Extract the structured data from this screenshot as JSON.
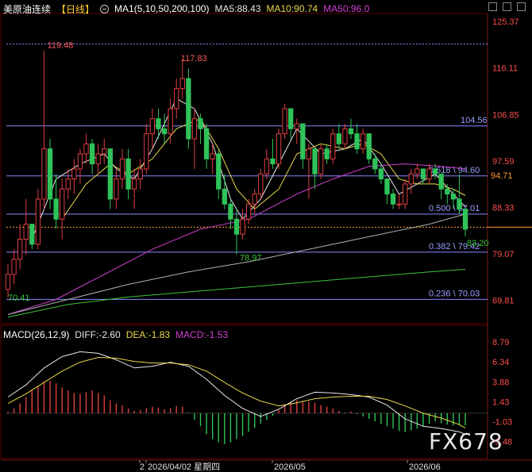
{
  "header": {
    "title": "美原油连续",
    "period": "【日线】",
    "ma_label": "MA1(5,10,50,200,100)",
    "ma5": "MA5:88.43",
    "ma10": "MA10:90.74",
    "ma50": "MA50:96.0"
  },
  "macd_header": {
    "label": "MACD(26,12,9)",
    "diff": "DIFF:-2.60",
    "dea": "DEA:-1.83",
    "macd": "MACD:-1.53"
  },
  "colors": {
    "background": "#000000",
    "up": "#e04040",
    "down": "#2fc35a",
    "ma5": "#e8e8e8",
    "ma10": "#e8d84a",
    "ma50": "#d040d0",
    "ma200": "#b0b0b0",
    "ma100": "#3cc43c",
    "fib_line": "#8a8aff",
    "current_price": "#ff9a2e",
    "price_axis": "#ff4d4d",
    "macd_axis": "#ff4d4d"
  },
  "watermark": "FX678",
  "chart_data": [
    {
      "type": "candlestick",
      "title": "美原油连续【日线】",
      "ylim": [
        65.5,
        126.8
      ],
      "y_ticks": [
        "125.37",
        "116.11",
        "106.85",
        "97.59",
        "88.33",
        "79.07",
        "69.81"
      ],
      "x_ticks": [
        "2",
        "2026/04/02 星期四",
        "2026/05",
        "2026/06"
      ],
      "current_price": "94.71",
      "extremes": {
        "high": "119.48",
        "high2": "117.83",
        "low": "70.41",
        "low2": "78.97",
        "last_low": "83.20"
      },
      "fib_levels": [
        {
          "label": "104.56",
          "value": 104.56
        },
        {
          "label": "0.618 \\ 94.60",
          "value": 94.6
        },
        {
          "label": "0.500 \\ 87.01",
          "value": 87.01
        },
        {
          "label": "0.382 \\ 79.42",
          "value": 79.42
        },
        {
          "label": "0.236 \\ 70.03",
          "value": 70.03
        }
      ],
      "dotted_lines": [
        120.9,
        84.4
      ],
      "ohlc": [
        [
          72,
          77,
          70.4,
          75
        ],
        [
          75,
          80,
          73,
          78
        ],
        [
          78,
          85,
          76,
          82
        ],
        [
          82,
          90,
          79,
          85
        ],
        [
          85,
          84,
          80,
          81
        ],
        [
          81,
          92,
          80,
          90
        ],
        [
          90,
          119.48,
          88,
          100
        ],
        [
          100,
          102,
          88,
          90
        ],
        [
          90,
          95,
          84,
          86
        ],
        [
          86,
          94,
          82,
          92
        ],
        [
          92,
          96,
          90,
          94
        ],
        [
          94,
          98,
          91,
          96
        ],
        [
          96,
          100,
          93,
          99
        ],
        [
          99,
          103,
          97,
          101
        ],
        [
          101,
          102,
          95,
          97
        ],
        [
          97,
          101,
          95,
          99
        ],
        [
          99,
          102,
          97,
          100
        ],
        [
          100,
          99,
          88,
          90
        ],
        [
          90,
          96,
          88,
          94
        ],
        [
          94,
          100,
          92,
          98
        ],
        [
          98,
          100,
          90,
          92
        ],
        [
          92,
          96,
          88,
          94
        ],
        [
          94,
          98,
          92,
          96
        ],
        [
          96,
          105,
          95,
          103
        ],
        [
          103,
          108,
          100,
          106
        ],
        [
          106,
          108,
          102,
          104
        ],
        [
          104,
          107,
          101,
          103
        ],
        [
          103,
          110,
          101,
          108
        ],
        [
          108,
          114,
          106,
          112
        ],
        [
          112,
          117.83,
          110,
          114
        ],
        [
          114,
          116,
          100,
          102
        ],
        [
          102,
          108,
          96,
          106
        ],
        [
          106,
          107,
          101,
          104
        ],
        [
          104,
          105,
          96,
          98
        ],
        [
          98,
          101,
          95,
          99
        ],
        [
          99,
          100,
          90,
          92
        ],
        [
          92,
          95,
          88,
          89
        ],
        [
          89,
          90,
          84,
          86
        ],
        [
          86,
          88,
          78.97,
          83
        ],
        [
          83,
          88,
          82,
          86
        ],
        [
          86,
          90,
          85,
          89
        ],
        [
          89,
          92,
          87,
          91
        ],
        [
          91,
          96,
          90,
          95
        ],
        [
          95,
          100,
          94,
          98
        ],
        [
          98,
          102,
          96,
          97
        ],
        [
          97,
          104,
          96,
          103
        ],
        [
          103,
          109,
          102,
          108
        ],
        [
          108,
          107,
          102,
          104
        ],
        [
          104,
          106,
          101,
          105
        ],
        [
          105,
          102,
          96,
          98
        ],
        [
          98,
          101,
          90,
          100
        ],
        [
          100,
          98,
          92,
          95
        ],
        [
          95,
          101,
          94,
          100
        ],
        [
          100,
          101,
          97,
          98
        ],
        [
          98,
          104,
          97,
          103
        ],
        [
          103,
          105,
          100,
          101
        ],
        [
          101,
          105,
          100,
          104
        ],
        [
          104,
          106,
          102,
          103
        ],
        [
          103,
          105,
          99,
          100
        ],
        [
          100,
          104,
          99,
          103
        ],
        [
          103,
          102,
          97,
          98
        ],
        [
          98,
          99,
          95,
          96
        ],
        [
          96,
          97,
          93,
          94
        ],
        [
          94,
          93,
          89,
          91
        ],
        [
          91,
          92,
          88,
          89
        ],
        [
          89,
          91,
          88,
          89
        ],
        [
          89,
          94,
          88,
          93
        ],
        [
          93,
          96,
          91,
          95
        ],
        [
          95,
          97,
          94,
          96
        ],
        [
          96,
          95,
          93,
          94
        ],
        [
          94,
          97,
          93,
          96
        ],
        [
          96,
          97,
          94,
          95
        ],
        [
          95,
          94,
          90,
          92
        ],
        [
          92,
          93,
          89,
          91
        ],
        [
          91,
          92,
          88,
          90
        ],
        [
          90,
          95,
          87,
          88
        ],
        [
          88,
          86,
          82.6,
          84
        ]
      ],
      "ma_series": {
        "ma5": {
          "start": 4,
          "end": 76,
          "points": [
            [
              4,
              82
            ],
            [
              8,
              94
            ],
            [
              12,
              97
            ],
            [
              16,
              99
            ],
            [
              18,
              96
            ],
            [
              21,
              94
            ],
            [
              24,
              100
            ],
            [
              28,
              110
            ],
            [
              31,
              108
            ],
            [
              34,
              101
            ],
            [
              37,
              90
            ],
            [
              39,
              86
            ],
            [
              42,
              90
            ],
            [
              45,
              97
            ],
            [
              48,
              104
            ],
            [
              52,
              99
            ],
            [
              56,
              100
            ],
            [
              59,
              102
            ],
            [
              62,
              97
            ],
            [
              65,
              91
            ],
            [
              68,
              93
            ],
            [
              71,
              95
            ],
            [
              74,
              91
            ],
            [
              76,
              88.4
            ]
          ]
        },
        "ma10": {
          "start": 9,
          "end": 76,
          "points": [
            [
              9,
              86
            ],
            [
              13,
              93
            ],
            [
              17,
              97
            ],
            [
              20,
              95
            ],
            [
              24,
              98
            ],
            [
              28,
              104
            ],
            [
              32,
              106
            ],
            [
              35,
              100
            ],
            [
              38,
              92
            ],
            [
              41,
              88
            ],
            [
              45,
              92
            ],
            [
              48,
              99
            ],
            [
              52,
              101
            ],
            [
              56,
              100
            ],
            [
              59,
              101
            ],
            [
              62,
              99
            ],
            [
              65,
              94
            ],
            [
              68,
              93
            ],
            [
              71,
              93
            ],
            [
              74,
              92
            ],
            [
              76,
              90.7
            ]
          ]
        },
        "ma50": {
          "start": 0,
          "end": 76,
          "points": [
            [
              0,
              67
            ],
            [
              8,
              70
            ],
            [
              16,
              75
            ],
            [
              24,
              80
            ],
            [
              32,
              84
            ],
            [
              40,
              86
            ],
            [
              48,
              91
            ],
            [
              54,
              94
            ],
            [
              60,
              96.5
            ],
            [
              66,
              97
            ],
            [
              72,
              96.5
            ],
            [
              76,
              96
            ]
          ]
        },
        "ma200": {
          "start": 0,
          "end": 76,
          "points": [
            [
              0,
              67
            ],
            [
              10,
              70
            ],
            [
              20,
              73
            ],
            [
              30,
              75.5
            ],
            [
              40,
              77.5
            ],
            [
              50,
              80
            ],
            [
              60,
              82.5
            ],
            [
              70,
              85
            ],
            [
              76,
              87
            ]
          ]
        },
        "ma100": {
          "start": 0,
          "end": 76,
          "points": [
            [
              0,
              66.5
            ],
            [
              10,
              69
            ],
            [
              20,
              70.5
            ],
            [
              30,
              71.5
            ],
            [
              40,
              72.5
            ],
            [
              50,
              73.5
            ],
            [
              60,
              74.5
            ],
            [
              70,
              75.5
            ],
            [
              76,
              76
            ]
          ]
        }
      }
    },
    {
      "type": "bar",
      "title": "MACD(26,12,9)",
      "ylim": [
        -5.2,
        9.3
      ],
      "y_ticks": [
        "8.79",
        "6.34",
        "3.88",
        "1.43",
        "-1.03",
        "-3.48"
      ],
      "x_ticks": [
        "2",
        "2026/04/02 星期四",
        "2026/05",
        "2026/06"
      ],
      "macd_bars": [
        0.2,
        0.6,
        1.2,
        2.0,
        2.8,
        3.4,
        3.9,
        4.0,
        3.7,
        3.2,
        2.8,
        2.5,
        2.4,
        2.6,
        2.8,
        2.5,
        2.2,
        1.6,
        1.2,
        1.0,
        0.6,
        0.3,
        0.4,
        0.6,
        0.8,
        0.7,
        0.5,
        0.6,
        0.9,
        0.8,
        0.1,
        -0.8,
        -1.6,
        -2.6,
        -3.2,
        -3.6,
        -3.8,
        -3.6,
        -3.2,
        -2.8,
        -2.3,
        -1.8,
        -1.3,
        -0.8,
        -0.3,
        0.4,
        1.0,
        1.4,
        1.6,
        1.5,
        1.4,
        1.3,
        1.0,
        0.8,
        0.6,
        0.3,
        0.1,
        0.2,
        -0.1,
        -0.4,
        -0.7,
        -1.0,
        -1.3,
        -1.6,
        -1.9,
        -2.2,
        -2.3,
        -2.1,
        -1.9,
        -1.6,
        -1.3,
        -1.0,
        -1.2,
        -1.4,
        -1.5,
        -1.5,
        -1.53
      ],
      "diff": [
        [
          0,
          2.0
        ],
        [
          3,
          3.5
        ],
        [
          6,
          5.6
        ],
        [
          9,
          7.0
        ],
        [
          12,
          7.6
        ],
        [
          15,
          7.4
        ],
        [
          18,
          6.6
        ],
        [
          21,
          5.6
        ],
        [
          24,
          5.8
        ],
        [
          27,
          6.3
        ],
        [
          30,
          5.8
        ],
        [
          33,
          4.2
        ],
        [
          36,
          2.2
        ],
        [
          39,
          0.6
        ],
        [
          42,
          -0.4
        ],
        [
          45,
          0.5
        ],
        [
          48,
          1.8
        ],
        [
          51,
          2.6
        ],
        [
          54,
          2.5
        ],
        [
          57,
          2.3
        ],
        [
          60,
          2.0
        ],
        [
          63,
          1.0
        ],
        [
          66,
          -0.7
        ],
        [
          69,
          -1.6
        ],
        [
          72,
          -1.9
        ],
        [
          75,
          -2.3
        ],
        [
          76,
          -2.6
        ]
      ],
      "dea": [
        [
          0,
          1.2
        ],
        [
          3,
          2.4
        ],
        [
          6,
          3.8
        ],
        [
          9,
          5.2
        ],
        [
          12,
          6.3
        ],
        [
          15,
          6.9
        ],
        [
          18,
          6.8
        ],
        [
          21,
          6.4
        ],
        [
          24,
          6.2
        ],
        [
          27,
          6.2
        ],
        [
          30,
          6.0
        ],
        [
          33,
          5.2
        ],
        [
          36,
          3.8
        ],
        [
          39,
          2.5
        ],
        [
          42,
          1.5
        ],
        [
          45,
          0.9
        ],
        [
          48,
          1.3
        ],
        [
          51,
          1.8
        ],
        [
          54,
          2.0
        ],
        [
          57,
          2.1
        ],
        [
          60,
          2.1
        ],
        [
          63,
          1.7
        ],
        [
          66,
          0.9
        ],
        [
          69,
          0.0
        ],
        [
          72,
          -0.6
        ],
        [
          75,
          -1.4
        ],
        [
          76,
          -1.83
        ]
      ]
    }
  ]
}
